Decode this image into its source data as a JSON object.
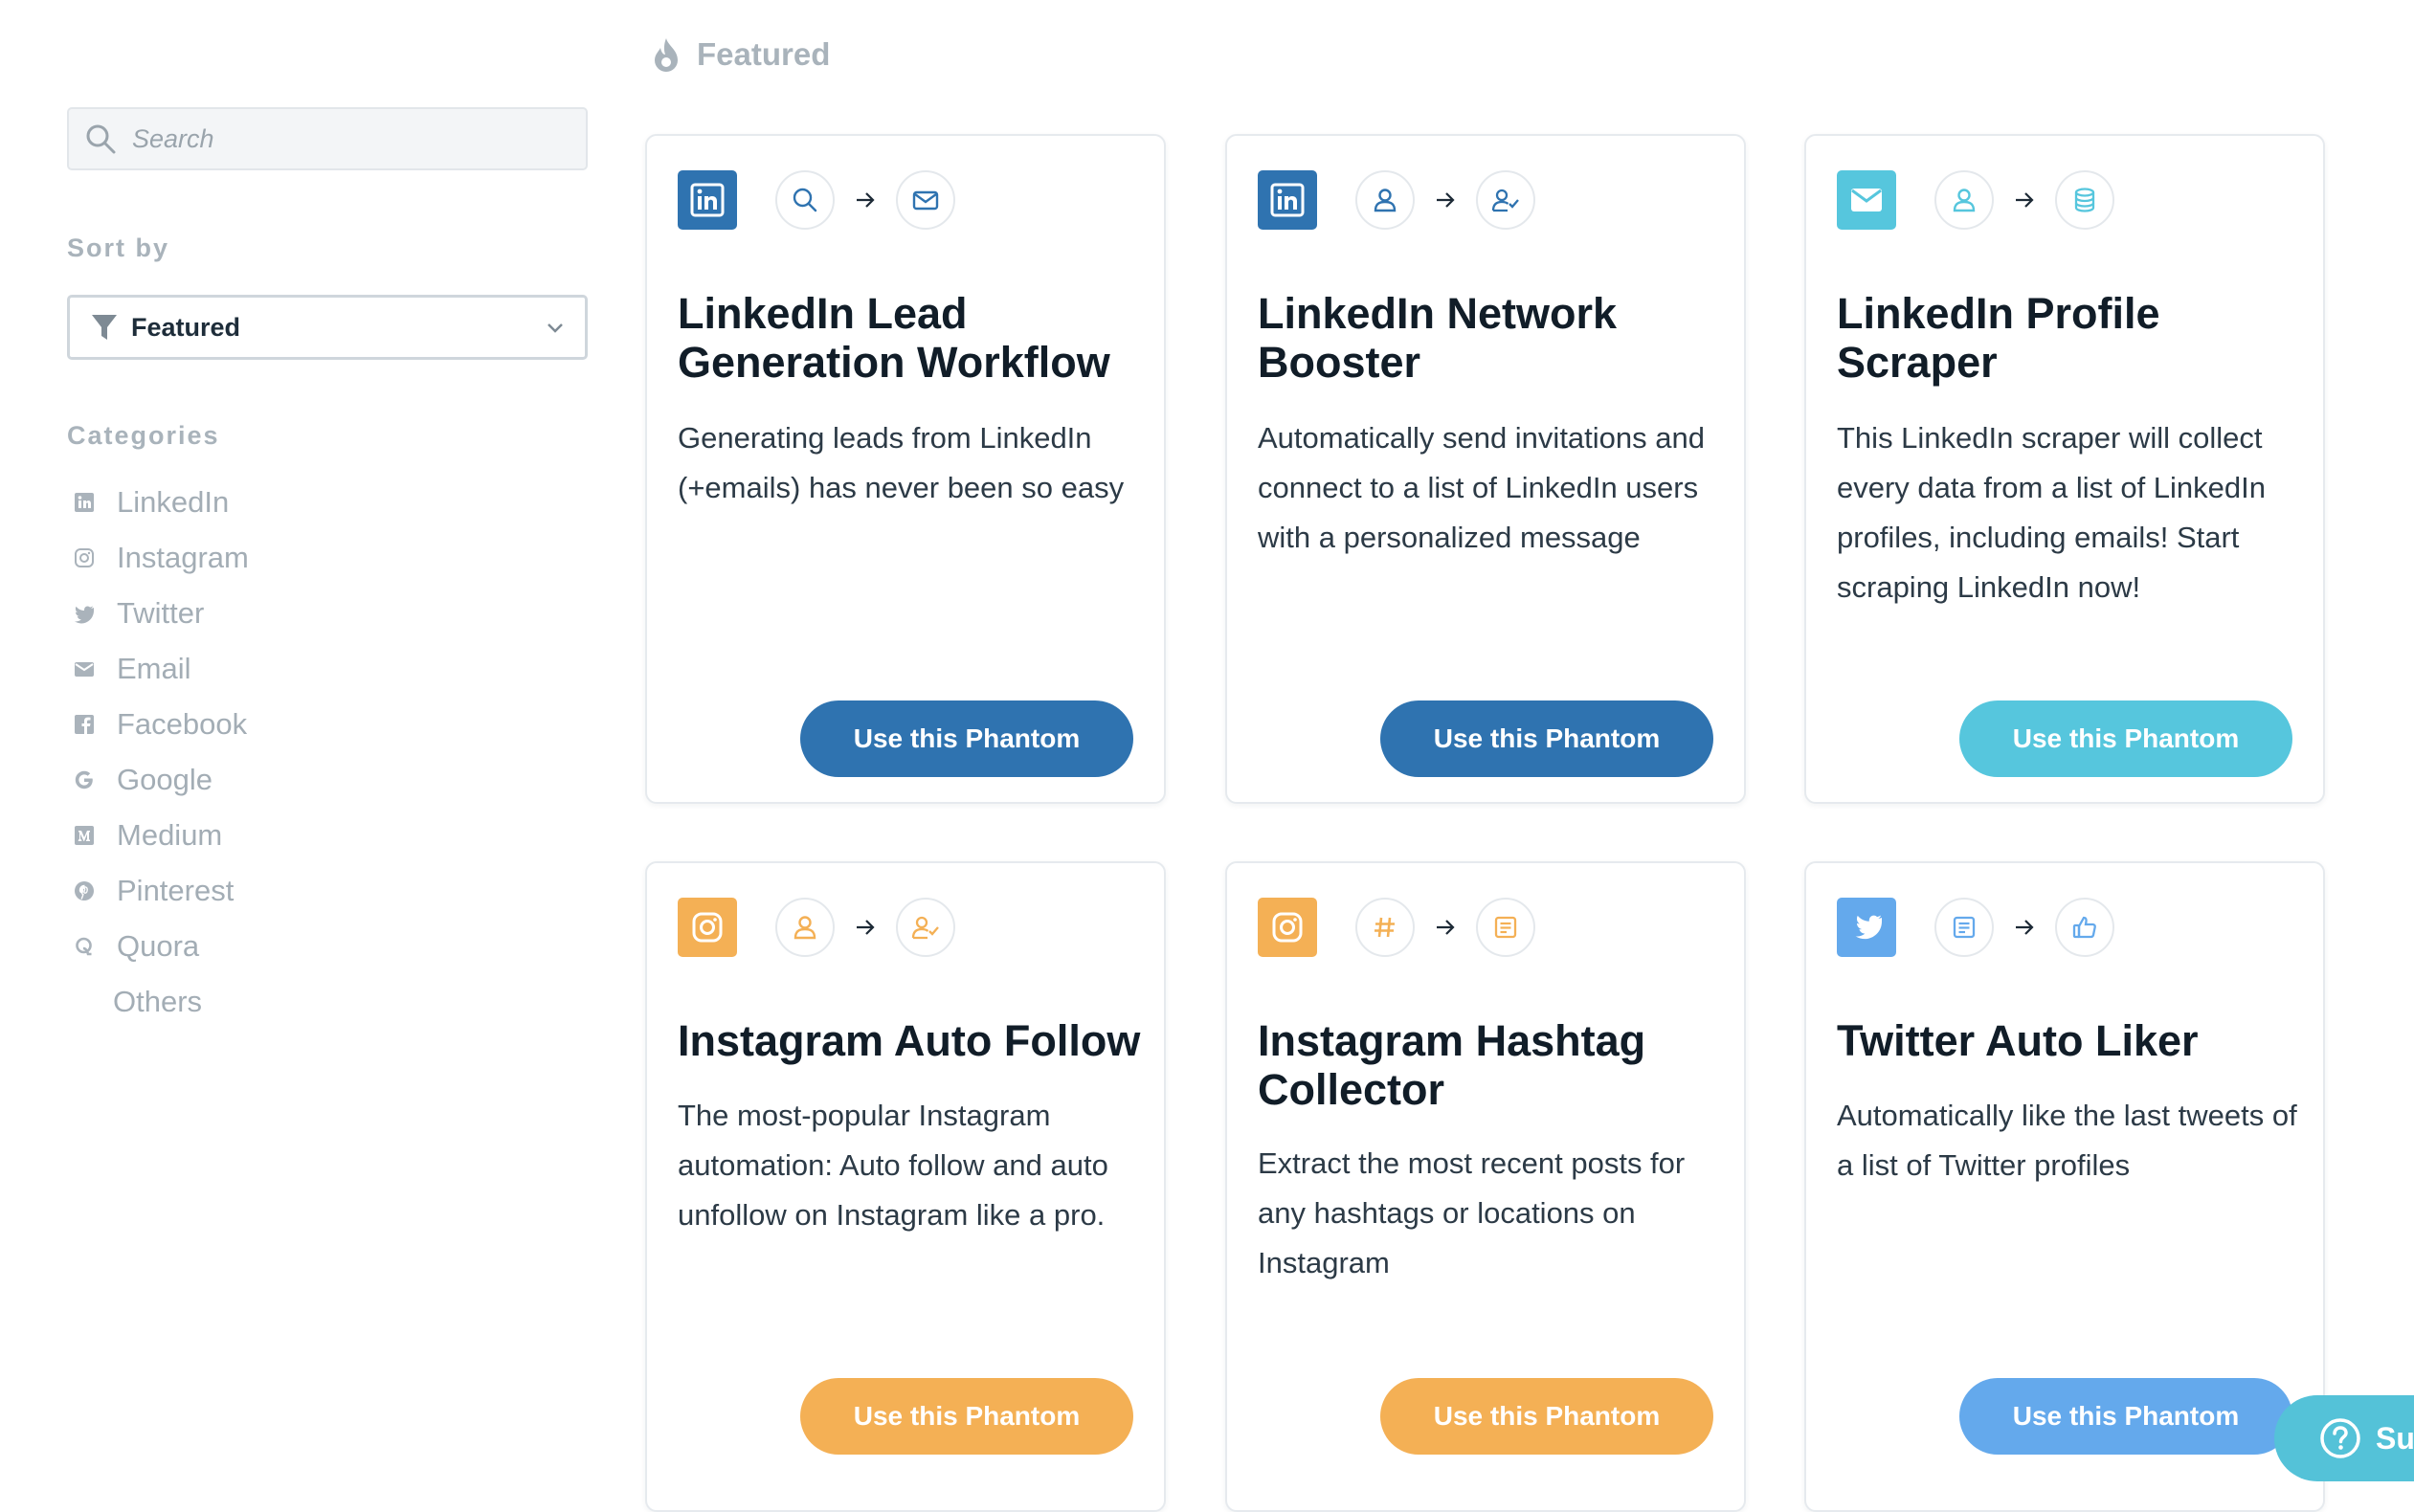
{
  "header": {
    "title": "Featured",
    "icon": "flame-icon"
  },
  "sidebar": {
    "search_placeholder": "Search",
    "sort_label": "Sort by",
    "sort_value": "Featured",
    "categories_label": "Categories",
    "categories": [
      {
        "label": "LinkedIn",
        "icon": "linkedin-icon"
      },
      {
        "label": "Instagram",
        "icon": "instagram-icon"
      },
      {
        "label": "Twitter",
        "icon": "twitter-icon"
      },
      {
        "label": "Email",
        "icon": "email-icon"
      },
      {
        "label": "Facebook",
        "icon": "facebook-icon"
      },
      {
        "label": "Google",
        "icon": "google-icon"
      },
      {
        "label": "Medium",
        "icon": "medium-icon"
      },
      {
        "label": "Pinterest",
        "icon": "pinterest-icon"
      },
      {
        "label": "Quora",
        "icon": "quora-icon"
      },
      {
        "label": "Others",
        "icon": ""
      }
    ]
  },
  "colors": {
    "linkedin": "#2f73b0",
    "email": "#56c6dd",
    "instagram": "#f4b055",
    "twitter": "#64a9ec"
  },
  "cards": [
    {
      "title": "LinkedIn Lead Generation Workflow",
      "description": "Generating leads from LinkedIn (+emails) has never been so easy",
      "button": "Use this Phantom",
      "brand_icon": "linkedin-icon",
      "flow": [
        "search-icon",
        "email-icon"
      ]
    },
    {
      "title": "LinkedIn Network Booster",
      "description": "Automatically send invitations and connect to a list of LinkedIn users with a personalized message",
      "button": "Use this Phantom",
      "brand_icon": "linkedin-icon",
      "flow": [
        "user-icon",
        "user-check-icon"
      ]
    },
    {
      "title": "LinkedIn Profile Scraper",
      "description": "This LinkedIn scraper will collect every data from a list of LinkedIn profiles, including emails! Start scraping LinkedIn now!",
      "button": "Use this Phantom",
      "brand_icon": "email-icon",
      "flow": [
        "user-icon",
        "database-icon"
      ]
    },
    {
      "title": "Instagram Auto Follow",
      "description": "The most-popular Instagram automation: Auto follow and auto unfollow on Instagram like a pro.",
      "button": "Use this Phantom",
      "brand_icon": "instagram-icon",
      "flow": [
        "user-icon",
        "user-check-icon"
      ]
    },
    {
      "title": "Instagram Hashtag Collector",
      "description": "Extract the most recent posts for any hashtags or locations on Instagram",
      "button": "Use this Phantom",
      "brand_icon": "instagram-icon",
      "flow": [
        "hashtag-icon",
        "document-icon"
      ]
    },
    {
      "title": "Twitter Auto Liker",
      "description": "Automatically like the last tweets of a list of Twitter profiles",
      "button": "Use this Phantom",
      "brand_icon": "twitter-icon",
      "flow": [
        "document-icon",
        "thumbs-up-icon"
      ]
    }
  ],
  "support": {
    "label": "Sup"
  }
}
